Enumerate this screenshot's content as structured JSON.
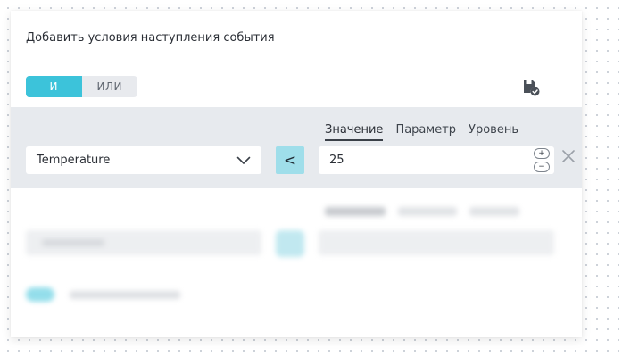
{
  "dialog": {
    "title": "Добавить условия наступления события"
  },
  "logic_toggle": {
    "and_label": "И",
    "or_label": "ИЛИ",
    "active": "and"
  },
  "condition": {
    "tabs": [
      {
        "label": "Значение",
        "active": true
      },
      {
        "label": "Параметр",
        "active": false
      },
      {
        "label": "Уровень",
        "active": false
      }
    ],
    "parameter": "Temperature",
    "operator": "<",
    "value": "25",
    "stepper_plus": "+",
    "stepper_minus": "−"
  },
  "icons": {
    "save": "save-check-icon",
    "dropdown": "chevron-down-icon",
    "close": "close-icon"
  },
  "colors": {
    "accent": "#3cc3da",
    "operator_bg": "#9fdeea",
    "condition_row_bg": "#e7eaee"
  }
}
